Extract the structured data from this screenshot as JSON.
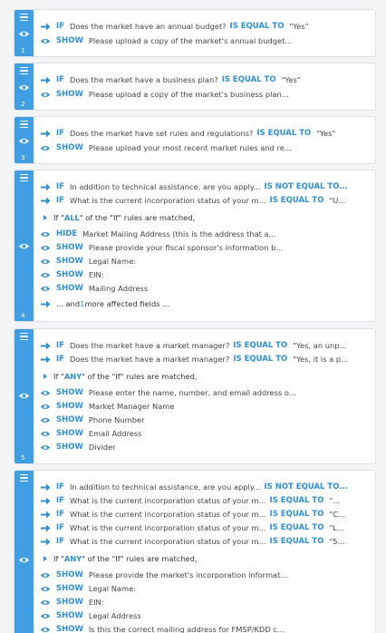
{
  "colors": {
    "accent": "#3f9fe2",
    "keyword": "#2f8fd8"
  },
  "icons": {
    "handle_menu": "menu-icon",
    "handle_eye": "eye-icon",
    "condition": "arrow-right-icon",
    "show": "eye-icon",
    "hide": "eye-icon",
    "more": "arrow-right-icon"
  },
  "rules": [
    {
      "number": "1",
      "conditions": [
        {
          "kw": "IF",
          "field": "Does the market have an annual budget?",
          "op": "IS EQUAL TO",
          "value": "\"Yes\""
        }
      ],
      "actions": [
        {
          "kw": "SHOW",
          "text": "Please upload a copy of the market's annual budget..."
        }
      ]
    },
    {
      "number": "2",
      "conditions": [
        {
          "kw": "IF",
          "field": "Does the market have a business plan?",
          "op": "IS EQUAL TO",
          "value": "\"Yes\""
        }
      ],
      "actions": [
        {
          "kw": "SHOW",
          "text": "Please upload a copy of the market's business plan..."
        }
      ]
    },
    {
      "number": "3",
      "conditions": [
        {
          "kw": "IF",
          "field": "Does the market have set rules and regulations?",
          "op": "IS EQUAL TO",
          "value": "\"Yes\""
        }
      ],
      "actions": [
        {
          "kw": "SHOW",
          "text": "Please upload your most recent market rules and re..."
        }
      ]
    },
    {
      "number": "4",
      "conditions": [
        {
          "kw": "IF",
          "field": "In addition to technical assistance, are you apply...",
          "op": "IS NOT EQUAL TO...",
          "value": ""
        },
        {
          "kw": "IF",
          "field": "What is the current incorporation status of your m...",
          "op": "IS EQUAL TO",
          "value": "\"U..."
        }
      ],
      "match": {
        "pre": "If \"",
        "word": "ALL",
        "post": "\" of the \"If\" rules are matched,"
      },
      "actions": [
        {
          "kw": "HIDE",
          "text": "Market Mailing Address (this is the address that a..."
        },
        {
          "kw": "SHOW",
          "text": "Please provide your fiscal sponsor's information b..."
        },
        {
          "kw": "SHOW",
          "text": "Legal Name:"
        },
        {
          "kw": "SHOW",
          "text": "EIN:"
        },
        {
          "kw": "SHOW",
          "text": "Mailing Address"
        }
      ],
      "more": {
        "pre": "... and ",
        "count": "1",
        "post": " more affected fields ..."
      }
    },
    {
      "number": "5",
      "conditions": [
        {
          "kw": "IF",
          "field": "Does the market have a market manager?",
          "op": "IS EQUAL TO",
          "value": "\"Yes, an unp..."
        },
        {
          "kw": "IF",
          "field": "Does the market have a market manager?",
          "op": "IS EQUAL TO",
          "value": "\"Yes, it is a p..."
        }
      ],
      "match": {
        "pre": "If \"",
        "word": "ANY",
        "post": "\" of the \"If\" rules are matched,"
      },
      "actions": [
        {
          "kw": "SHOW",
          "text": "Please enter the name, number, and email address o..."
        },
        {
          "kw": "SHOW",
          "text": "Market Manager Name"
        },
        {
          "kw": "SHOW",
          "text": "Phone Number"
        },
        {
          "kw": "SHOW",
          "text": "Email Address"
        },
        {
          "kw": "SHOW",
          "text": "Divider"
        }
      ]
    },
    {
      "number": "",
      "conditions": [
        {
          "kw": "IF",
          "field": "In addition to technical assistance, are you apply...",
          "op": "IS NOT EQUAL TO...",
          "value": ""
        },
        {
          "kw": "IF",
          "field": "What is the current incorporation status of your m...",
          "op": "IS EQUAL TO",
          "value": "\"..."
        },
        {
          "kw": "IF",
          "field": "What is the current incorporation status of your m...",
          "op": "IS EQUAL TO",
          "value": "\"C..."
        },
        {
          "kw": "IF",
          "field": "What is the current incorporation status of your m...",
          "op": "IS EQUAL TO",
          "value": "\"L..."
        },
        {
          "kw": "IF",
          "field": "What is the current incorporation status of your m...",
          "op": "IS EQUAL TO",
          "value": "\"5..."
        }
      ],
      "match": {
        "pre": "If \"",
        "word": "ANY",
        "post": "\" of the \"If\" rules are matched,"
      },
      "actions": [
        {
          "kw": "SHOW",
          "text": "Please provide the market's incorporation informat..."
        },
        {
          "kw": "SHOW",
          "text": "Legal Name:"
        },
        {
          "kw": "SHOW",
          "text": "EIN:"
        },
        {
          "kw": "SHOW",
          "text": "Legal Address"
        },
        {
          "kw": "SHOW",
          "text": "Is this the correct mailing address for FMSP/KDD c..."
        }
      ]
    }
  ]
}
